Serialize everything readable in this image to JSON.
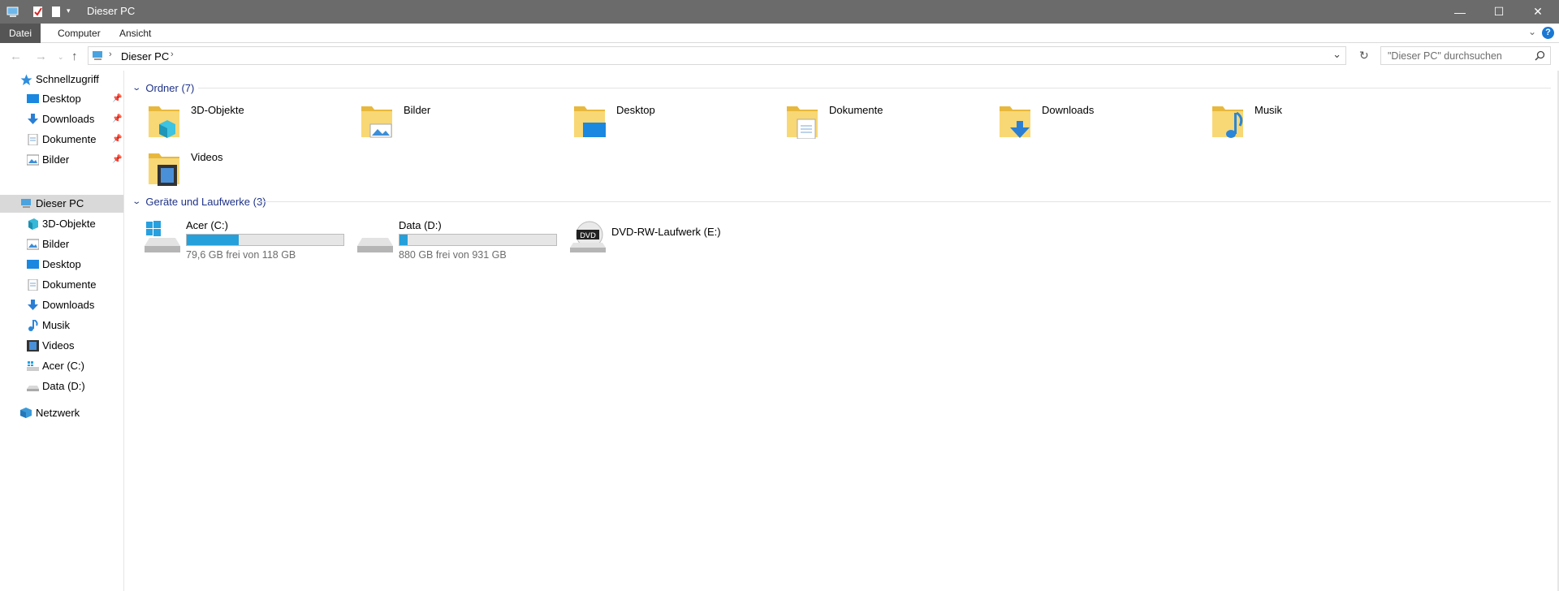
{
  "window": {
    "title": "Dieser PC"
  },
  "ribbon": {
    "tabs": [
      "Datei",
      "Computer",
      "Ansicht"
    ],
    "help": "?"
  },
  "nav": {
    "breadcrumb": "Dieser PC",
    "search_placeholder": "\"Dieser PC\" durchsuchen"
  },
  "sidebar": {
    "quick_access": "Schnellzugriff",
    "quick_items": [
      "Desktop",
      "Downloads",
      "Dokumente",
      "Bilder"
    ],
    "this_pc": "Dieser PC",
    "pc_items": [
      "3D-Objekte",
      "Bilder",
      "Desktop",
      "Dokumente",
      "Downloads",
      "Musik",
      "Videos",
      "Acer (C:)",
      "Data (D:)"
    ],
    "network": "Netzwerk"
  },
  "folders": {
    "header": "Ordner (7)",
    "items": [
      "3D-Objekte",
      "Bilder",
      "Desktop",
      "Dokumente",
      "Downloads",
      "Musik",
      "Videos"
    ]
  },
  "drives": {
    "header": "Geräte und Laufwerke (3)",
    "items": [
      {
        "name": "Acer (C:)",
        "info": "79,6 GB frei von 118 GB",
        "used_fraction": 0.33
      },
      {
        "name": "Data (D:)",
        "info": "880 GB frei von 931 GB",
        "used_fraction": 0.05
      },
      {
        "name": "DVD-RW-Laufwerk (E:)"
      }
    ]
  },
  "colors": {
    "accent": "#26a0da",
    "group_header": "#1e3287",
    "titlebar": "#6b6b6b"
  }
}
